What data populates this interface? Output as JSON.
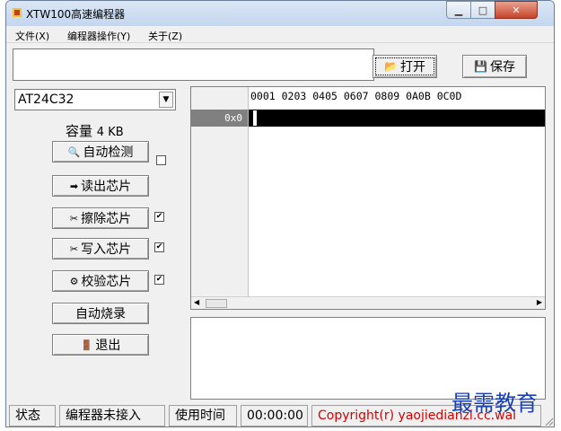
{
  "window": {
    "title": "XTW100高速编程器"
  },
  "menu": [
    "文件(X)",
    "编程器操作(Y)",
    "关于(Z)"
  ],
  "toolbar": {
    "file_path": "",
    "open_label": "打开",
    "save_label": "保存"
  },
  "chip": {
    "selected": "AT24C32",
    "capacity_label": "容量",
    "capacity_value": "4 KB"
  },
  "actions": {
    "auto_detect": {
      "label": "自动检测",
      "checked": false
    },
    "read_chip": {
      "label": "读出芯片"
    },
    "erase_chip": {
      "label": "擦除芯片",
      "checked": true
    },
    "write_chip": {
      "label": "写入芯片",
      "checked": true
    },
    "verify_chip": {
      "label": "校验芯片",
      "checked": true
    },
    "auto_burn": {
      "label": "自动烧录"
    },
    "exit": {
      "label": "退出"
    }
  },
  "hex": {
    "header": "0001 0203 0405 0607 0809 0A0B 0C0D",
    "rows": [
      {
        "addr": "0x0"
      }
    ]
  },
  "status": {
    "state_label": "状态",
    "state_value": "编程器未接入",
    "time_label": "使用时间",
    "time_value": "00:00:00",
    "copyright": "Copyright(r) yaojiedianzi.cc.wai"
  },
  "watermark": "最需教育",
  "colors": {
    "copyright": "#d40000",
    "watermark": "#1a3fb0",
    "hex_row": "#000000"
  }
}
